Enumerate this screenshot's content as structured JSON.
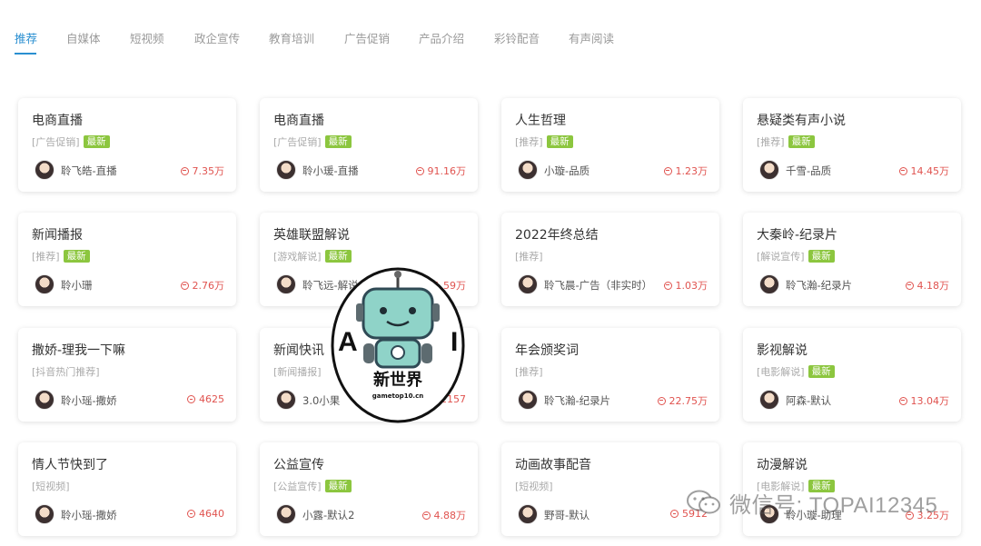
{
  "tabs": [
    {
      "label": "推荐",
      "active": true
    },
    {
      "label": "自媒体"
    },
    {
      "label": "短视频"
    },
    {
      "label": "政企宣传"
    },
    {
      "label": "教育培训"
    },
    {
      "label": "广告促销"
    },
    {
      "label": "产品介绍"
    },
    {
      "label": "彩铃配音"
    },
    {
      "label": "有声阅读"
    }
  ],
  "cards": [
    {
      "title": "电商直播",
      "tag": "[广告促销]",
      "new": "最新",
      "speaker": "聆飞皓-直播",
      "plays": "7.35万"
    },
    {
      "title": "电商直播",
      "tag": "[广告促销]",
      "new": "最新",
      "speaker": "聆小瑗-直播",
      "plays": "91.16万"
    },
    {
      "title": "人生哲理",
      "tag": "[推荐]",
      "new": "最新",
      "speaker": "小璇-品质",
      "plays": "1.23万"
    },
    {
      "title": "悬疑类有声小说",
      "tag": "[推荐]",
      "new": "最新",
      "speaker": "千雪-品质",
      "plays": "14.45万"
    },
    {
      "title": "新闻播报",
      "tag": "[推荐]",
      "new": "最新",
      "speaker": "聆小珊",
      "plays": "2.76万"
    },
    {
      "title": "英雄联盟解说",
      "tag": "[游戏解说]",
      "new": "最新",
      "speaker": "聆飞远-解说",
      "plays": "1.59万"
    },
    {
      "title": "2022年终总结",
      "tag": "[推荐]",
      "new": "",
      "speaker": "聆飞晨-广告（非实时）",
      "plays": "1.03万"
    },
    {
      "title": "大秦岭-纪录片",
      "tag": "[解说宣传]",
      "new": "最新",
      "speaker": "聆飞瀚-纪录片",
      "plays": "4.18万"
    },
    {
      "title": "撒娇-理我一下嘛",
      "tag": "[抖音热门推荐]",
      "new": "",
      "speaker": "聆小瑶-撒娇",
      "plays": "4625"
    },
    {
      "title": "新闻快讯",
      "tag": "[新闻播报]",
      "new": "",
      "speaker": "3.0小果",
      "plays": "2157"
    },
    {
      "title": "年会颁奖词",
      "tag": "[推荐]",
      "new": "",
      "speaker": "聆飞瀚-纪录片",
      "plays": "22.75万"
    },
    {
      "title": "影视解说",
      "tag": "[电影解说]",
      "new": "最新",
      "speaker": "阿森-默认",
      "plays": "13.04万"
    },
    {
      "title": "情人节快到了",
      "tag": "[短视频]",
      "new": "",
      "speaker": "聆小瑶-撒娇",
      "plays": "4640"
    },
    {
      "title": "公益宣传",
      "tag": "[公益宣传]",
      "new": "最新",
      "speaker": "小露-默认2",
      "plays": "4.88万"
    },
    {
      "title": "动画故事配音",
      "tag": "[短视频]",
      "new": "",
      "speaker": "野哥-默认",
      "plays": "5912"
    },
    {
      "title": "动漫解说",
      "tag": "[电影解说]",
      "new": "最新",
      "speaker": "聆小璇-助理",
      "plays": "3.25万"
    }
  ],
  "watermark": {
    "logo_left": "A",
    "logo_right": "I",
    "logo_name": "新世界",
    "logo_url": "gametop10.cn",
    "wechat_text": "微信号: TOPAI12345"
  },
  "colors": {
    "accent": "#2a8fd1",
    "new_badge": "#8cc63f",
    "plays": "#e0534f"
  }
}
